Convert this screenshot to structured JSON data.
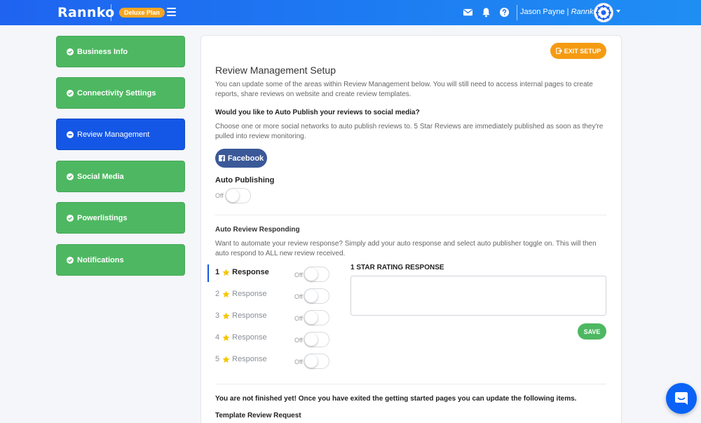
{
  "header": {
    "logo": "Rannko",
    "plan_badge": "Deluxe Plan",
    "user_name": "Jason Payne",
    "separator": "|",
    "company": "Rannko",
    "icons": [
      "mail-icon",
      "bell-icon",
      "help-icon",
      "avatar",
      "chevron-down-icon"
    ]
  },
  "sidebar": {
    "items": [
      {
        "label": "Business Info",
        "status": "complete"
      },
      {
        "label": "Connectivity Settings",
        "status": "complete"
      },
      {
        "label": "Review Management",
        "status": "active"
      },
      {
        "label": "Social Media",
        "status": "complete"
      },
      {
        "label": "Powerlistings",
        "status": "complete"
      },
      {
        "label": "Notifications",
        "status": "complete"
      }
    ]
  },
  "main": {
    "exit_button": "EXIT SETUP",
    "title": "Review Management Setup",
    "intro": "You can update some of the areas within Review Management below. You will still need to access internal pages to create reports, share reviews on website and create review templates.",
    "auto_publish_question": "Would you like to Auto Publish your reviews to social media?",
    "auto_publish_desc": "Choose one or more social networks to auto publish reviews to. 5 Star Reviews are immediately published as soon as they're pulled into review monitoring.",
    "facebook_button": "Facebook",
    "auto_publishing_label": "Auto Publishing",
    "auto_publishing_toggle": "Off",
    "auto_responding_title": "Auto Review Responding",
    "auto_responding_desc": "Want to automate your review response? Simply add your auto response and select auto publisher toggle on. This will then auto respond to ALL new review received.",
    "responses": [
      {
        "num": "1",
        "label": "Response",
        "toggle": "Off",
        "active": true
      },
      {
        "num": "2",
        "label": "Response",
        "toggle": "Off",
        "active": false
      },
      {
        "num": "3",
        "label": "Response",
        "toggle": "Off",
        "active": false
      },
      {
        "num": "4",
        "label": "Response",
        "toggle": "Off",
        "active": false
      },
      {
        "num": "5",
        "label": "Response",
        "toggle": "Off",
        "active": false
      }
    ],
    "response_title": "1 STAR RATING RESPONSE",
    "response_value": "",
    "save_button": "SAVE",
    "not_finished": "You are not finished yet! Once you have exited the getting started pages you can update the following items.",
    "template_title": "Template Review Request"
  },
  "colors": {
    "header_gradient_start": "#1f63f0",
    "header_gradient_end": "#1f8ef3",
    "sidebar_complete": "#4db861",
    "sidebar_active": "#1457e6",
    "exit_button": "#f59b12",
    "facebook": "#3b5998",
    "save_button": "#4db861",
    "star": "#f7c600"
  }
}
